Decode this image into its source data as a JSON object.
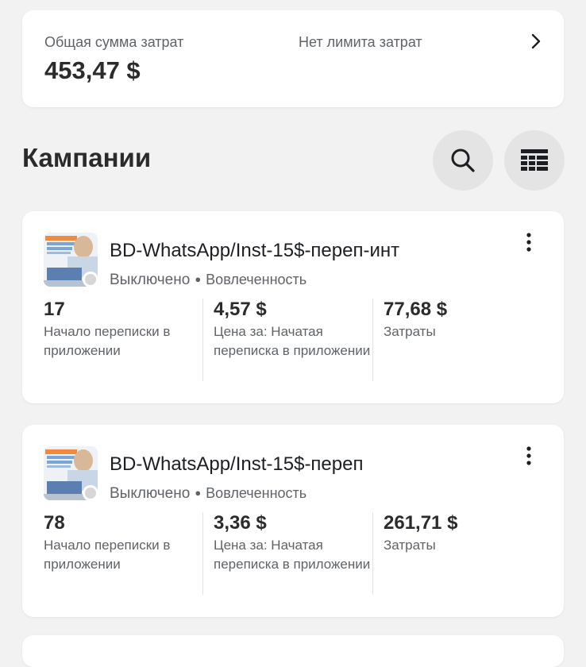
{
  "summary": {
    "spend_label": "Общая сумма затрат",
    "spend_value": "453,47 $",
    "limit_label": "Нет лимита затрат"
  },
  "section_title": "Кампании",
  "icons": {
    "search": "search-icon",
    "table": "table-view-icon",
    "chevron": "chevron-right-icon",
    "more": "more-vertical-icon"
  },
  "campaigns": [
    {
      "name": "BD-WhatsApp/Inst-15$-переп-инт",
      "status": "Выключено",
      "objective": "Вовлеченность",
      "metrics": [
        {
          "value": "17",
          "label": "Начало переписки в приложении"
        },
        {
          "value": "4,57 $",
          "label": "Цена за: Начатая переписка в приложении"
        },
        {
          "value": "77,68 $",
          "label": "Затраты"
        }
      ]
    },
    {
      "name": "BD-WhatsApp/Inst-15$-переп",
      "status": "Выключено",
      "objective": "Вовлеченность",
      "metrics": [
        {
          "value": "78",
          "label": "Начало переписки в приложении"
        },
        {
          "value": "3,36 $",
          "label": "Цена за: Начатая переписка в приложении"
        },
        {
          "value": "261,71 $",
          "label": "Затраты"
        }
      ]
    }
  ],
  "colors": {
    "background": "#f2f2f2",
    "card": "#ffffff",
    "button": "#e4e4e4",
    "text_primary": "#1c1e21",
    "text_secondary": "#5f6368",
    "status_off": "#d7d7d7"
  }
}
